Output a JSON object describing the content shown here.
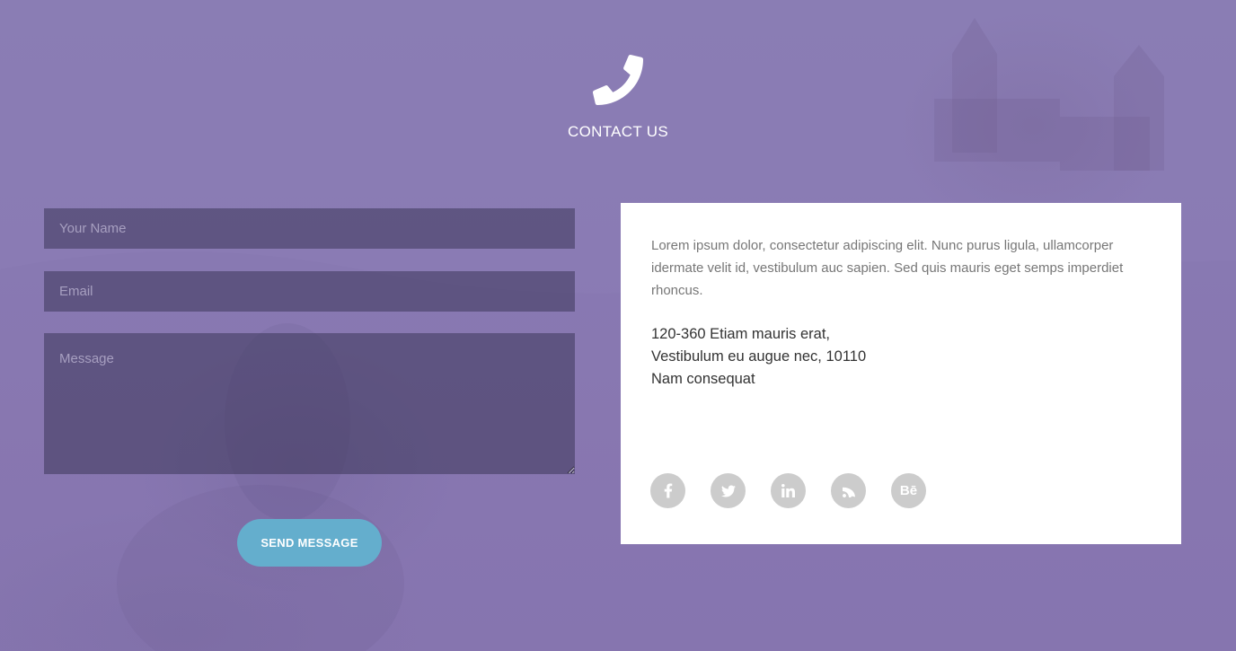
{
  "header": {
    "title": "CONTACT US",
    "icon": "phone-icon"
  },
  "form": {
    "name_placeholder": "Your Name",
    "email_placeholder": "Email",
    "message_placeholder": "Message",
    "submit_label": "SEND MESSAGE"
  },
  "info": {
    "description": "Lorem ipsum dolor, consectetur adipiscing elit. Nunc purus ligula, ullamcorper idermate velit id, vestibulum auc sapien. Sed quis mauris eget semps imperdiet rhoncus.",
    "address_lines": [
      "120-360 Etiam mauris erat,",
      "Vestibulum eu augue nec, 10110",
      "Nam consequat"
    ]
  },
  "social": [
    {
      "name": "facebook-icon"
    },
    {
      "name": "twitter-icon"
    },
    {
      "name": "linkedin-icon"
    },
    {
      "name": "rss-icon"
    },
    {
      "name": "behance-icon",
      "label": "Bē"
    }
  ],
  "colors": {
    "background": "#8a7bb3",
    "field_bg": "#5a5078",
    "button": "#64aecd",
    "card": "#ffffff",
    "social_icon_bg": "#cccccc"
  }
}
